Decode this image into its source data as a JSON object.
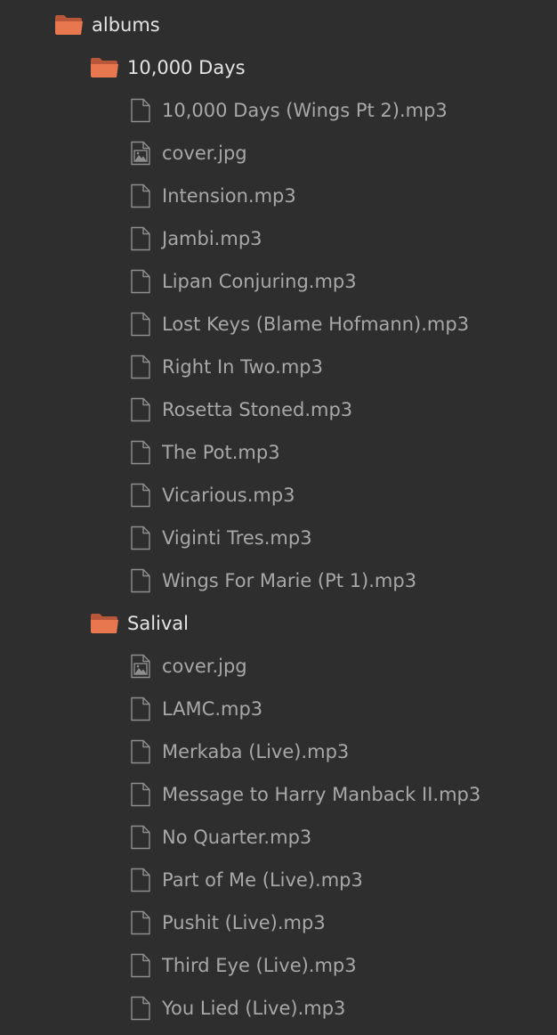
{
  "colors": {
    "background": "#2e2e2e",
    "folder_icon": "#e8774f",
    "folder_label": "#e4e4e4",
    "file_label": "#a8a8a8",
    "file_icon": "#8e8e8e"
  },
  "tree": {
    "root": {
      "label": "albums",
      "icon": "folder-open-icon",
      "children": [
        {
          "label": "10,000 Days",
          "icon": "folder-open-icon",
          "files": [
            {
              "label": "10,000 Days (Wings Pt 2).mp3",
              "icon": "file-icon"
            },
            {
              "label": "cover.jpg",
              "icon": "image-file-icon"
            },
            {
              "label": "Intension.mp3",
              "icon": "file-icon"
            },
            {
              "label": "Jambi.mp3",
              "icon": "file-icon"
            },
            {
              "label": "Lipan Conjuring.mp3",
              "icon": "file-icon"
            },
            {
              "label": "Lost Keys (Blame Hofmann).mp3",
              "icon": "file-icon"
            },
            {
              "label": "Right In Two.mp3",
              "icon": "file-icon"
            },
            {
              "label": "Rosetta Stoned.mp3",
              "icon": "file-icon"
            },
            {
              "label": "The Pot.mp3",
              "icon": "file-icon"
            },
            {
              "label": "Vicarious.mp3",
              "icon": "file-icon"
            },
            {
              "label": "Viginti Tres.mp3",
              "icon": "file-icon"
            },
            {
              "label": "Wings For Marie (Pt 1).mp3",
              "icon": "file-icon"
            }
          ]
        },
        {
          "label": "Salival",
          "icon": "folder-open-icon",
          "files": [
            {
              "label": "cover.jpg",
              "icon": "image-file-icon"
            },
            {
              "label": "LAMC.mp3",
              "icon": "file-icon"
            },
            {
              "label": "Merkaba (Live).mp3",
              "icon": "file-icon"
            },
            {
              "label": "Message to Harry Manback II.mp3",
              "icon": "file-icon"
            },
            {
              "label": "No Quarter.mp3",
              "icon": "file-icon"
            },
            {
              "label": "Part of Me (Live).mp3",
              "icon": "file-icon"
            },
            {
              "label": "Pushit (Live).mp3",
              "icon": "file-icon"
            },
            {
              "label": "Third Eye (Live).mp3",
              "icon": "file-icon"
            },
            {
              "label": "You Lied (Live).mp3",
              "icon": "file-icon"
            }
          ]
        }
      ]
    }
  }
}
